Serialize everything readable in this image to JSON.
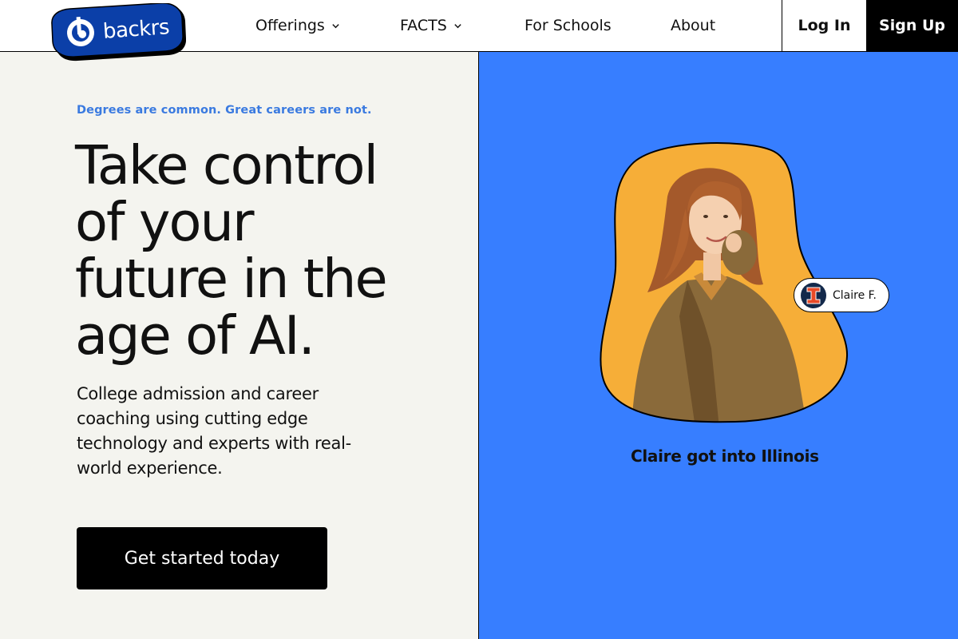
{
  "brand": {
    "name": "backrs"
  },
  "nav": {
    "items": [
      {
        "label": "Offerings",
        "has_dropdown": true
      },
      {
        "label": "FACTS",
        "has_dropdown": true
      },
      {
        "label": "For Schools",
        "has_dropdown": false
      },
      {
        "label": "About",
        "has_dropdown": false
      }
    ],
    "login_label": "Log In",
    "signup_label": "Sign Up"
  },
  "hero": {
    "tagline": "Degrees are common. Great careers are not.",
    "headline_lines": [
      "Take control",
      "of your",
      "future in the",
      "age of AI."
    ],
    "subtext": "College admission and career coaching using cutting edge technology and experts with real-world experience.",
    "cta_label": "Get started today"
  },
  "testimonial": {
    "badge_name": "Claire F.",
    "caption": "Claire got into Illinois"
  },
  "colors": {
    "accent_blue": "#377eff",
    "tagline_blue": "#3a7ae0",
    "logo_blue": "#0b3fa8",
    "blob_orange": "#f6ae38",
    "panel_bg": "#f4f4ef",
    "illinois_navy": "#13294b",
    "illinois_orange": "#e84a27"
  }
}
